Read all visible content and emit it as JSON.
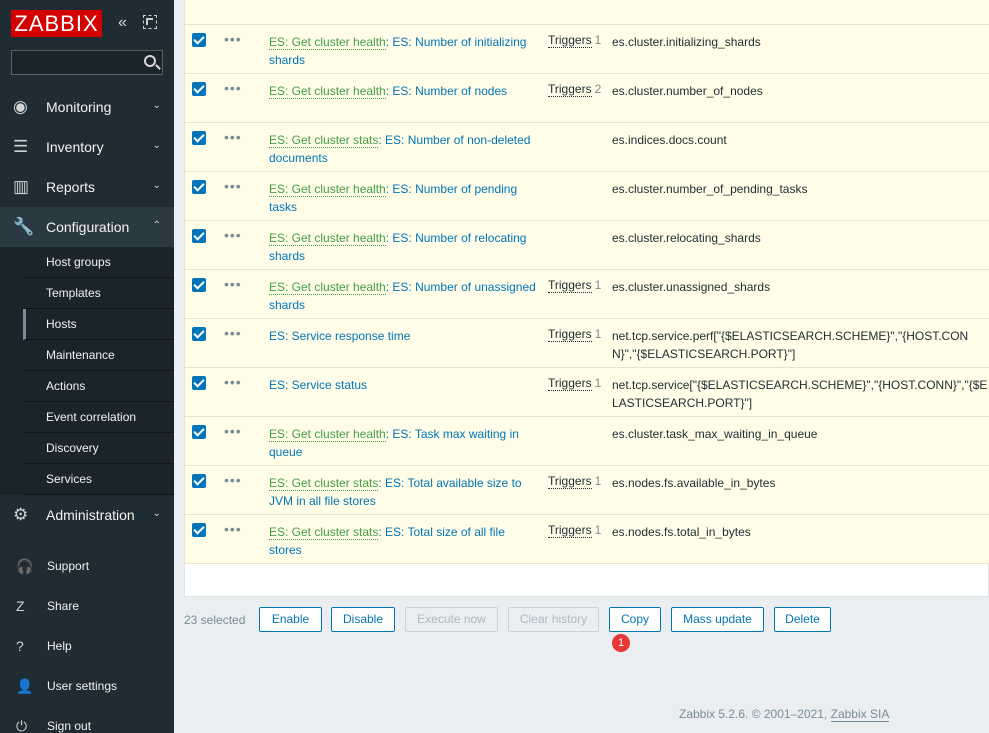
{
  "sidebar": {
    "logo": "ZABBIX",
    "collapse_icon": "collapse-icon",
    "kiosk_icon": "kiosk-icon",
    "search": {
      "value": "",
      "placeholder": ""
    },
    "menu": [
      {
        "label": "Monitoring",
        "icon": "eye-icon",
        "glyph": "◉"
      },
      {
        "label": "Inventory",
        "icon": "list-icon",
        "glyph": "☰"
      },
      {
        "label": "Reports",
        "icon": "chart-icon",
        "glyph": "▥"
      },
      {
        "label": "Configuration",
        "icon": "wrench-icon",
        "glyph": "🔧"
      }
    ],
    "submenu": [
      "Host groups",
      "Templates",
      "Hosts",
      "Maintenance",
      "Actions",
      "Event correlation",
      "Discovery",
      "Services"
    ],
    "selected_sub": "Hosts",
    "administration": {
      "label": "Administration",
      "icon": "gear-icon",
      "glyph": "⚙"
    },
    "lower": [
      {
        "label": "Support",
        "icon": "headset-icon",
        "glyph": "🎧"
      },
      {
        "label": "Share",
        "icon": "share-icon",
        "glyph": "Z"
      },
      {
        "label": "Help",
        "icon": "help-icon",
        "glyph": "?"
      },
      {
        "label": "User settings",
        "icon": "user-icon",
        "glyph": "👤"
      },
      {
        "label": "Sign out",
        "icon": "power-icon",
        "glyph": "⏻"
      }
    ]
  },
  "items": [
    {
      "parent": "ES: Get cluster health",
      "name": "ES: Number of initializing shards",
      "triggers": "Triggers",
      "trigger_count": "1",
      "key": "es.cluster.initializing_shards"
    },
    {
      "parent": "ES: Get cluster health",
      "name": "ES: Number of nodes",
      "triggers": "Triggers",
      "trigger_count": "2",
      "key": "es.cluster.number_of_nodes"
    },
    {
      "parent": "ES: Get cluster stats",
      "name": "ES: Number of non-deleted documents",
      "triggers": "",
      "trigger_count": "",
      "key": "es.indices.docs.count"
    },
    {
      "parent": "ES: Get cluster health",
      "name": "ES: Number of pending tasks",
      "triggers": "",
      "trigger_count": "",
      "key": "es.cluster.number_of_pending_tasks"
    },
    {
      "parent": "ES: Get cluster health",
      "name": "ES: Number of relocating shards",
      "triggers": "",
      "trigger_count": "",
      "key": "es.cluster.relocating_shards"
    },
    {
      "parent": "ES: Get cluster health",
      "name": "ES: Number of unassigned shards",
      "triggers": "Triggers",
      "trigger_count": "1",
      "key": "es.cluster.unassigned_shards"
    },
    {
      "parent": "",
      "name": "ES: Service response time",
      "triggers": "Triggers",
      "trigger_count": "1",
      "key": "net.tcp.service.perf[\"{$ELASTICSEARCH.SCHEME}\",\"{HOST.CONN}\",\"{$ELASTICSEARCH.PORT}\"]"
    },
    {
      "parent": "",
      "name": "ES: Service status",
      "triggers": "Triggers",
      "trigger_count": "1",
      "key": "net.tcp.service[\"{$ELASTICSEARCH.SCHEME}\",\"{HOST.CONN}\",\"{$ELASTICSEARCH.PORT}\"]"
    },
    {
      "parent": "ES: Get cluster health",
      "name": "ES: Task max waiting in queue",
      "triggers": "",
      "trigger_count": "",
      "key": "es.cluster.task_max_waiting_in_queue"
    },
    {
      "parent": "ES: Get cluster stats",
      "name": "ES: Total available size to JVM in all file stores",
      "triggers": "Triggers",
      "trigger_count": "1",
      "key": "es.nodes.fs.available_in_bytes"
    },
    {
      "parent": "ES: Get cluster stats",
      "name": "ES: Total size of all file stores",
      "triggers": "Triggers",
      "trigger_count": "1",
      "key": "es.nodes.fs.total_in_bytes"
    }
  ],
  "action_bar": {
    "selected_count": "23 selected",
    "buttons": [
      {
        "label": "Enable",
        "disabled": false
      },
      {
        "label": "Disable",
        "disabled": false
      },
      {
        "label": "Execute now",
        "disabled": true
      },
      {
        "label": "Clear history",
        "disabled": true
      },
      {
        "label": "Copy",
        "disabled": false
      },
      {
        "label": "Mass update",
        "disabled": false
      },
      {
        "label": "Delete",
        "disabled": false
      }
    ],
    "badge": "1"
  },
  "footer": {
    "text": "Zabbix 5.2.6. © 2001–2021, ",
    "company": "Zabbix SIA"
  }
}
